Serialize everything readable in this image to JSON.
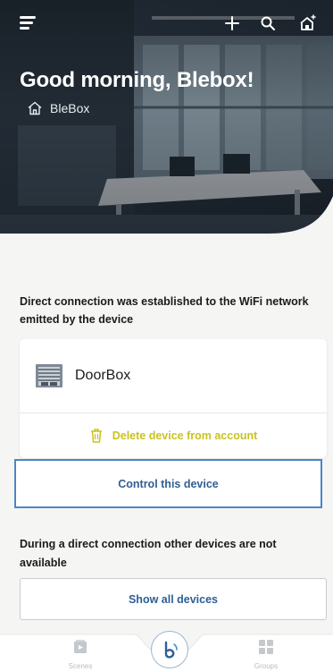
{
  "hero": {
    "greeting": "Good morning, Blebox!",
    "location": "BleBox"
  },
  "notice": "Direct connection was established to the WiFi network emitted by the device",
  "device": {
    "name": "DoorBox",
    "delete_label": "Delete device from account"
  },
  "actions": {
    "control_label": "Control this device",
    "show_all_label": "Show all devices"
  },
  "warning": "During a direct connection other devices are not available",
  "nav": {
    "scenes_label": "Scenes",
    "groups_label": "Groups"
  },
  "colors": {
    "accent_blue": "#4a87c4",
    "button_text": "#2f5e95",
    "delete_yellow": "#c9c31f"
  }
}
